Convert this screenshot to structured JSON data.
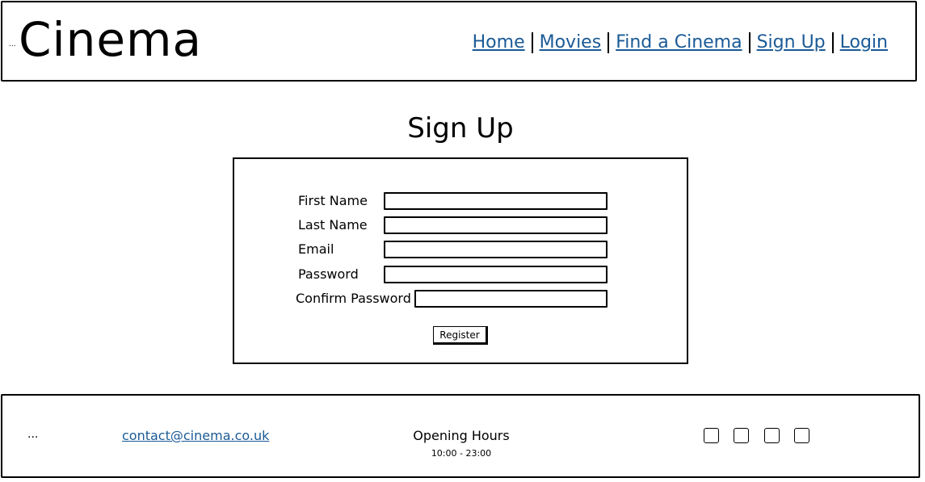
{
  "header": {
    "logo": "Cinema",
    "logo_dots": "...",
    "nav": {
      "home": "Home",
      "movies": "Movies",
      "find_cinema": "Find a Cinema",
      "sign_up": "Sign Up",
      "login": "Login"
    }
  },
  "page": {
    "title": "Sign Up"
  },
  "form": {
    "first_name_label": "First Name",
    "last_name_label": "Last Name",
    "email_label": "Email",
    "password_label": "Password",
    "confirm_password_label": "Confirm Password",
    "first_name_value": "",
    "last_name_value": "",
    "email_value": "",
    "password_value": "",
    "confirm_password_value": "",
    "register_label": "Register"
  },
  "footer": {
    "dots": "...",
    "email": "contact@cinema.co.uk",
    "hours_title": "Opening Hours",
    "hours_value": "10:00 - 23:00",
    "social_icons": [
      "social-icon-1",
      "social-icon-2",
      "social-icon-3",
      "social-icon-4"
    ]
  },
  "colors": {
    "link": "#1a5a96",
    "border": "#000000",
    "background": "#ffffff"
  }
}
